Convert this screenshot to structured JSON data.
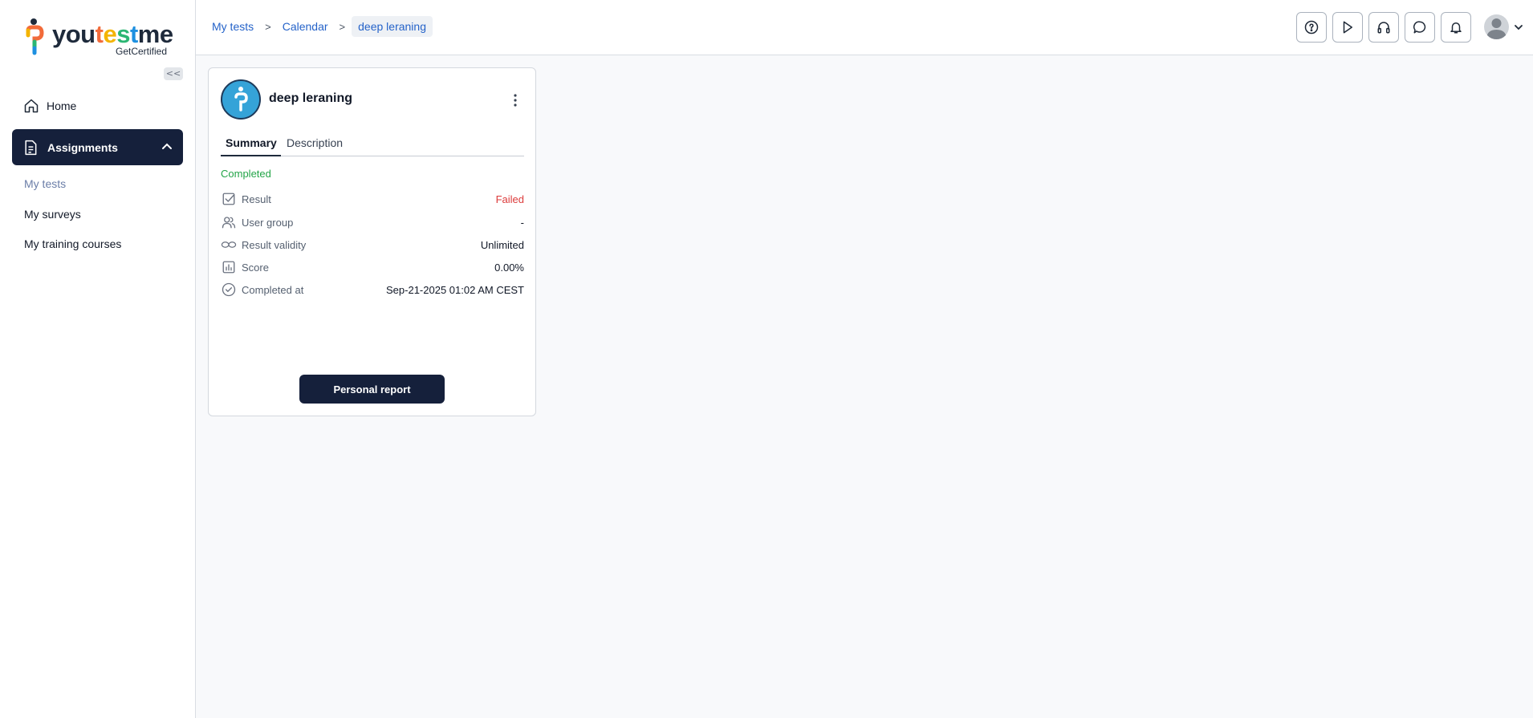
{
  "brand": {
    "wordmark_parts": [
      "you",
      "t",
      "e",
      "s",
      "t",
      "me"
    ],
    "tagline": "GetCertified",
    "colors": {
      "navy": "#15203b",
      "link": "#2563c9",
      "success": "#22a447",
      "danger": "#dc3b3b"
    }
  },
  "sidebar": {
    "collapse_label": "<<",
    "home_label": "Home",
    "section_label": "Assignments",
    "sub_items": [
      {
        "label": "My tests",
        "active": true
      },
      {
        "label": "My surveys",
        "active": false
      },
      {
        "label": "My training courses",
        "active": false
      }
    ]
  },
  "header": {
    "breadcrumbs": [
      "My tests",
      "Calendar",
      "deep leraning"
    ],
    "separator": ">",
    "icons": [
      "help-icon",
      "play-icon",
      "headset-icon",
      "chat-icon",
      "bell-icon",
      "avatar"
    ]
  },
  "card": {
    "title": "deep leraning",
    "tabs": [
      "Summary",
      "Description"
    ],
    "status": "Completed",
    "rows": [
      {
        "icon": "checkbox-icon",
        "key": "Result",
        "value": "Failed"
      },
      {
        "icon": "users-icon",
        "key": "User group",
        "value": "-"
      },
      {
        "icon": "infinity-icon",
        "key": "Result validity",
        "value": "Unlimited"
      },
      {
        "icon": "bar-chart-icon",
        "key": "Score",
        "value": "0.00%"
      },
      {
        "icon": "check-circle-icon",
        "key": "Completed at",
        "value": "Sep-21-2025 01:02 AM CEST"
      }
    ],
    "button_label": "Personal report"
  }
}
